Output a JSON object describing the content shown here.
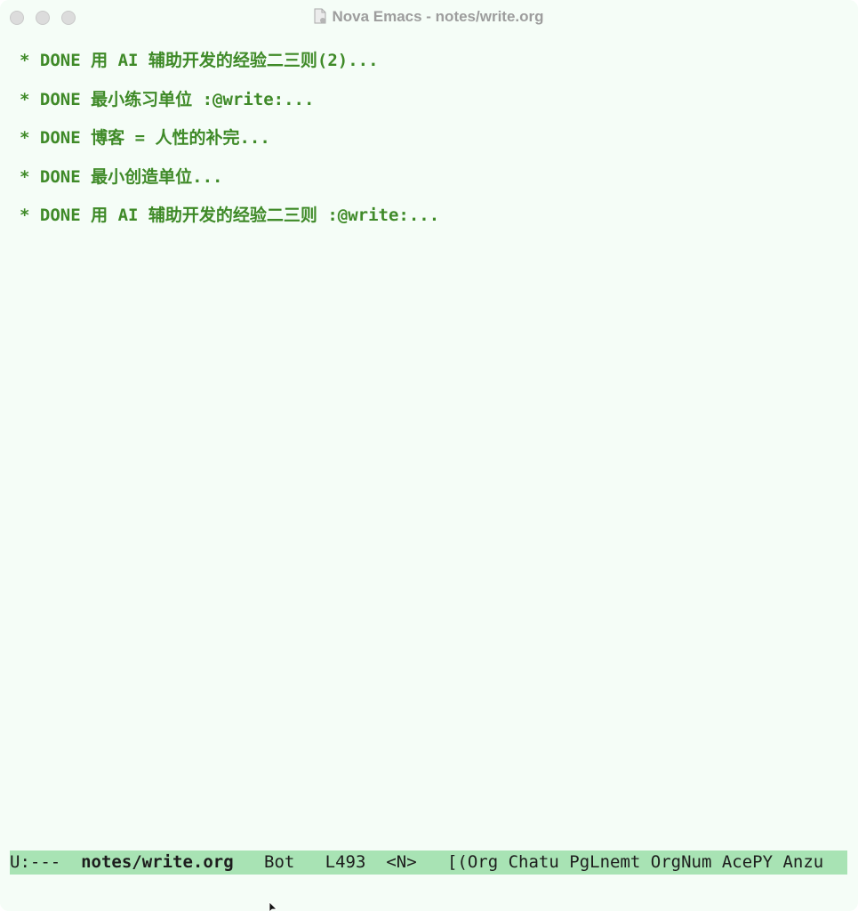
{
  "window": {
    "title": "Nova Emacs - notes/write.org"
  },
  "headings": [
    {
      "bullet": "*",
      "keyword": "DONE",
      "text": "用 AI 辅助开发的经验二三则(2)..."
    },
    {
      "bullet": "*",
      "keyword": "DONE",
      "text": "最小练习单位 :@write:..."
    },
    {
      "bullet": "*",
      "keyword": "DONE",
      "text": "博客 = 人性的补完..."
    },
    {
      "bullet": "*",
      "keyword": "DONE",
      "text": "最小创造单位..."
    },
    {
      "bullet": "*",
      "keyword": "DONE",
      "text": "用 AI 辅助开发的经验二三则 :@write:..."
    }
  ],
  "modeline": {
    "state": "U:---",
    "buffer": "notes/write.org",
    "position": "Bot",
    "line": "L493",
    "evil_state": "<N>",
    "modes": "[(Org Chatu PgLnemt OrgNum AcePY Anzu"
  },
  "colors": {
    "background": "#f5fdf7",
    "heading": "#3f8a28",
    "modeline_bg": "#a8e3b4",
    "title_text": "#9d9d9d"
  },
  "icons": [
    "close-window-icon",
    "minimize-window-icon",
    "maximize-window-icon",
    "document-icon",
    "mouse-pointer-icon"
  ]
}
